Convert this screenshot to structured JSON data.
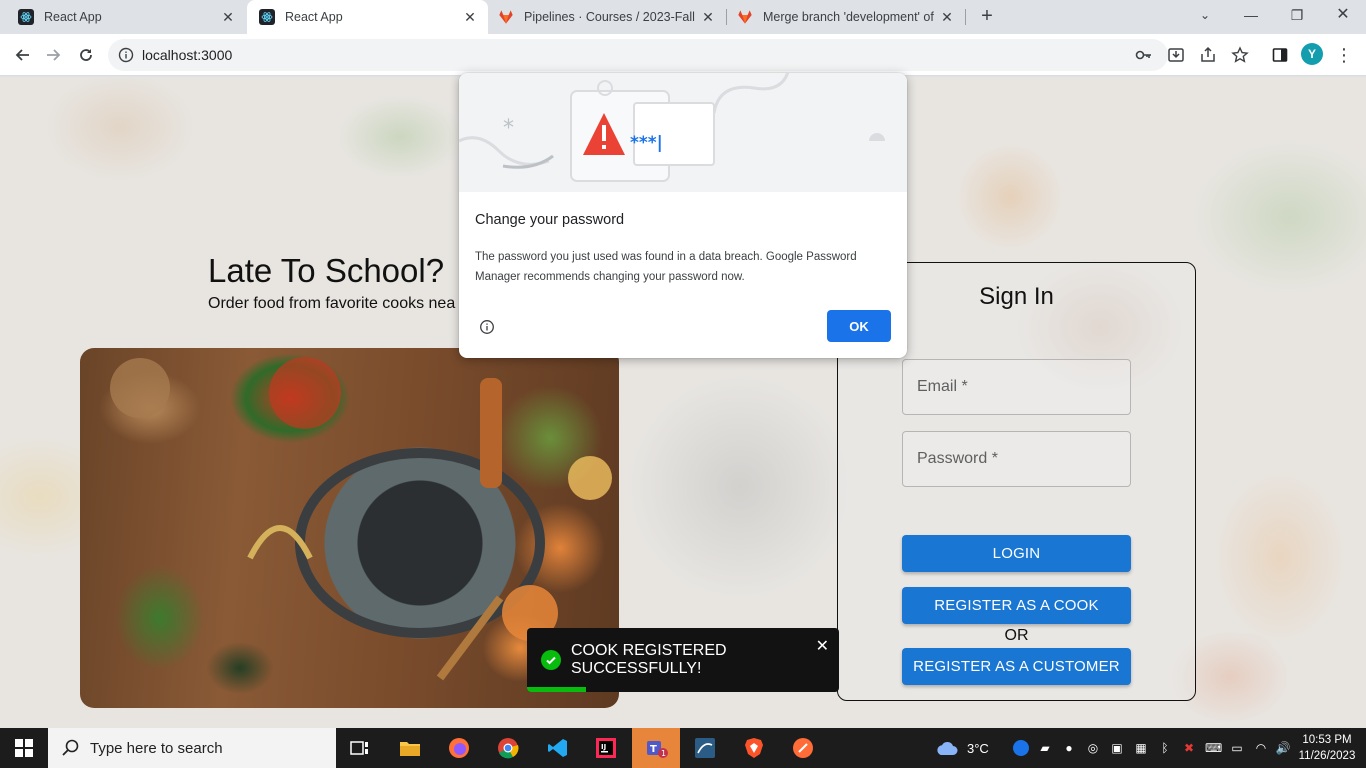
{
  "browser": {
    "tabs": [
      {
        "title": "React App",
        "active": false,
        "favicon": "react-icon"
      },
      {
        "title": "React App",
        "active": true,
        "favicon": "react-icon"
      },
      {
        "title": "Pipelines · Courses / 2023-Fall / ",
        "active": false,
        "favicon": "gitlab-icon"
      },
      {
        "title": "Merge branch 'development' of",
        "active": false,
        "favicon": "gitlab-icon"
      }
    ],
    "url": "localhost:3000",
    "profile_initial": "Y"
  },
  "hero": {
    "title": "Late To School?",
    "subtitle": "Order food from favorite cooks nea"
  },
  "signin": {
    "title": "Sign In",
    "email_label": "Email *",
    "password_label": "Password *",
    "login_label": "LOGIN",
    "register_cook_label": "REGISTER AS A COOK",
    "or_text": "OR",
    "register_customer_label": "REGISTER AS A CUSTOMER",
    "accent": "#1976d2"
  },
  "toast": {
    "message": "COOK REGISTERED SUCCESSFULLY!",
    "progress": 0.19,
    "color": "#07bc0c"
  },
  "password_dialog": {
    "title": "Change your password",
    "body": "The password you just used was found in a data breach. Google Password Manager recommends changing your password now.",
    "ok_label": "OK",
    "masked": "***|"
  },
  "taskbar": {
    "search_placeholder": "Type here to search",
    "weather": "3°C",
    "time": "10:53 PM",
    "date": "11/26/2023"
  }
}
